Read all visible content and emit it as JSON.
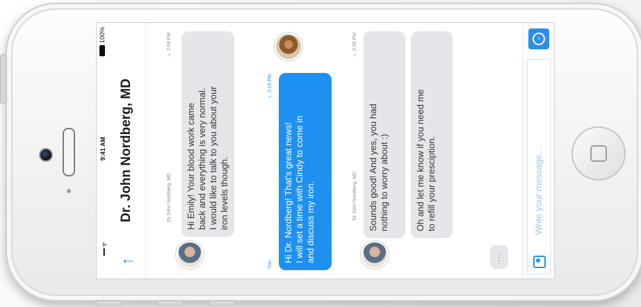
{
  "status": {
    "signal": "••••• ᯤ",
    "time": "9:41 AM",
    "battery": "100%"
  },
  "header": {
    "title": "Dr. John Nordberg, MD",
    "back_icon": "arrow-back-icon"
  },
  "messages": [
    {
      "sender": "Dr John Nordberg, MD",
      "time": "✓ 2:04 PM",
      "lines": [
        "Hi Emily!  Your blood work came",
        "back and everything is very normal.",
        "I would like to talk to you about your",
        "iron levels though."
      ]
    },
    {
      "sender": "You",
      "time": "✓ 2:19 PM",
      "lines": [
        "Hi Dr. Nordberg!  That's great news!",
        "I will set a time with Cindy to come in",
        "and discuss my iron."
      ]
    },
    {
      "sender": "Dr John Nordberg, MD",
      "time": "✓ 2:39 PM",
      "lines_a": [
        "Sounds good!  And yes, you had",
        "nothing to worry about :)"
      ],
      "lines_b": [
        "Oh and let me know if you need me",
        "to refill your presciption."
      ]
    }
  ],
  "typing": {
    "label": "⋮"
  },
  "composer": {
    "placeholder": "Write your message...",
    "send_icon": "send-icon",
    "attach_icon": "attach-icon"
  },
  "colors": {
    "accent": "#1e90ef",
    "bubble_gray": "#e6e6ea"
  }
}
